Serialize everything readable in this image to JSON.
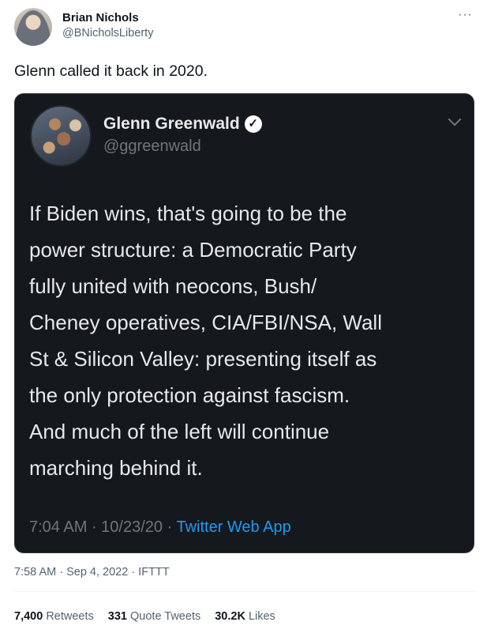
{
  "author": {
    "display_name": "Brian Nichols",
    "handle": "@BNicholsLiberty",
    "more_icon": "more-horizontal-icon"
  },
  "tweet_text": "Glenn called it back in 2020.",
  "quoted": {
    "display_name": "Glenn Greenwald",
    "verified_icon": "verified-check-icon",
    "handle": "@ggreenwald",
    "lines": [
      "If Biden wins, that's going to be the",
      "power structure: a Democratic Party",
      "fully united with neocons, Bush/",
      "Cheney operatives, CIA/FBI/NSA, Wall",
      "St & Silicon Valley: presenting itself as",
      "the only protection against fascism.",
      "And much of the left will continue",
      "marching behind it."
    ],
    "time": "7:04 AM",
    "date": "10/23/20",
    "source": "Twitter Web App"
  },
  "timestamp": "7:58 AM · Sep 4, 2022 · IFTTT",
  "stats": {
    "retweets_count": "7,400",
    "retweets_label": "Retweets",
    "quotes_count": "331",
    "quotes_label": "Quote Tweets",
    "likes_count": "30.2K",
    "likes_label": "Likes"
  },
  "colors": {
    "link_blue": "#1d9bf0",
    "dark_card": "#15181c",
    "muted_text": "#536471"
  }
}
